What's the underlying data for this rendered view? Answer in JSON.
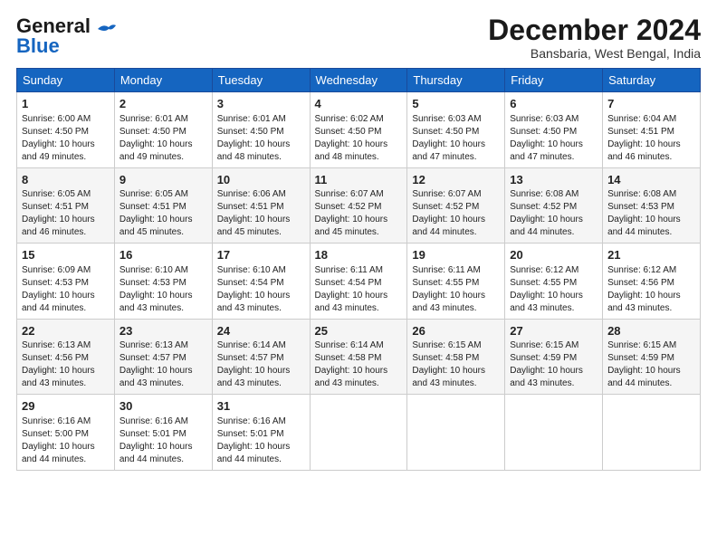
{
  "logo": {
    "line1": "General",
    "line2": "Blue"
  },
  "title": "December 2024",
  "location": "Bansbaria, West Bengal, India",
  "weekdays": [
    "Sunday",
    "Monday",
    "Tuesday",
    "Wednesday",
    "Thursday",
    "Friday",
    "Saturday"
  ],
  "weeks": [
    [
      {
        "day": "1",
        "info": "Sunrise: 6:00 AM\nSunset: 4:50 PM\nDaylight: 10 hours\nand 49 minutes."
      },
      {
        "day": "2",
        "info": "Sunrise: 6:01 AM\nSunset: 4:50 PM\nDaylight: 10 hours\nand 49 minutes."
      },
      {
        "day": "3",
        "info": "Sunrise: 6:01 AM\nSunset: 4:50 PM\nDaylight: 10 hours\nand 48 minutes."
      },
      {
        "day": "4",
        "info": "Sunrise: 6:02 AM\nSunset: 4:50 PM\nDaylight: 10 hours\nand 48 minutes."
      },
      {
        "day": "5",
        "info": "Sunrise: 6:03 AM\nSunset: 4:50 PM\nDaylight: 10 hours\nand 47 minutes."
      },
      {
        "day": "6",
        "info": "Sunrise: 6:03 AM\nSunset: 4:50 PM\nDaylight: 10 hours\nand 47 minutes."
      },
      {
        "day": "7",
        "info": "Sunrise: 6:04 AM\nSunset: 4:51 PM\nDaylight: 10 hours\nand 46 minutes."
      }
    ],
    [
      {
        "day": "8",
        "info": "Sunrise: 6:05 AM\nSunset: 4:51 PM\nDaylight: 10 hours\nand 46 minutes."
      },
      {
        "day": "9",
        "info": "Sunrise: 6:05 AM\nSunset: 4:51 PM\nDaylight: 10 hours\nand 45 minutes."
      },
      {
        "day": "10",
        "info": "Sunrise: 6:06 AM\nSunset: 4:51 PM\nDaylight: 10 hours\nand 45 minutes."
      },
      {
        "day": "11",
        "info": "Sunrise: 6:07 AM\nSunset: 4:52 PM\nDaylight: 10 hours\nand 45 minutes."
      },
      {
        "day": "12",
        "info": "Sunrise: 6:07 AM\nSunset: 4:52 PM\nDaylight: 10 hours\nand 44 minutes."
      },
      {
        "day": "13",
        "info": "Sunrise: 6:08 AM\nSunset: 4:52 PM\nDaylight: 10 hours\nand 44 minutes."
      },
      {
        "day": "14",
        "info": "Sunrise: 6:08 AM\nSunset: 4:53 PM\nDaylight: 10 hours\nand 44 minutes."
      }
    ],
    [
      {
        "day": "15",
        "info": "Sunrise: 6:09 AM\nSunset: 4:53 PM\nDaylight: 10 hours\nand 44 minutes."
      },
      {
        "day": "16",
        "info": "Sunrise: 6:10 AM\nSunset: 4:53 PM\nDaylight: 10 hours\nand 43 minutes."
      },
      {
        "day": "17",
        "info": "Sunrise: 6:10 AM\nSunset: 4:54 PM\nDaylight: 10 hours\nand 43 minutes."
      },
      {
        "day": "18",
        "info": "Sunrise: 6:11 AM\nSunset: 4:54 PM\nDaylight: 10 hours\nand 43 minutes."
      },
      {
        "day": "19",
        "info": "Sunrise: 6:11 AM\nSunset: 4:55 PM\nDaylight: 10 hours\nand 43 minutes."
      },
      {
        "day": "20",
        "info": "Sunrise: 6:12 AM\nSunset: 4:55 PM\nDaylight: 10 hours\nand 43 minutes."
      },
      {
        "day": "21",
        "info": "Sunrise: 6:12 AM\nSunset: 4:56 PM\nDaylight: 10 hours\nand 43 minutes."
      }
    ],
    [
      {
        "day": "22",
        "info": "Sunrise: 6:13 AM\nSunset: 4:56 PM\nDaylight: 10 hours\nand 43 minutes."
      },
      {
        "day": "23",
        "info": "Sunrise: 6:13 AM\nSunset: 4:57 PM\nDaylight: 10 hours\nand 43 minutes."
      },
      {
        "day": "24",
        "info": "Sunrise: 6:14 AM\nSunset: 4:57 PM\nDaylight: 10 hours\nand 43 minutes."
      },
      {
        "day": "25",
        "info": "Sunrise: 6:14 AM\nSunset: 4:58 PM\nDaylight: 10 hours\nand 43 minutes."
      },
      {
        "day": "26",
        "info": "Sunrise: 6:15 AM\nSunset: 4:58 PM\nDaylight: 10 hours\nand 43 minutes."
      },
      {
        "day": "27",
        "info": "Sunrise: 6:15 AM\nSunset: 4:59 PM\nDaylight: 10 hours\nand 43 minutes."
      },
      {
        "day": "28",
        "info": "Sunrise: 6:15 AM\nSunset: 4:59 PM\nDaylight: 10 hours\nand 44 minutes."
      }
    ],
    [
      {
        "day": "29",
        "info": "Sunrise: 6:16 AM\nSunset: 5:00 PM\nDaylight: 10 hours\nand 44 minutes."
      },
      {
        "day": "30",
        "info": "Sunrise: 6:16 AM\nSunset: 5:01 PM\nDaylight: 10 hours\nand 44 minutes."
      },
      {
        "day": "31",
        "info": "Sunrise: 6:16 AM\nSunset: 5:01 PM\nDaylight: 10 hours\nand 44 minutes."
      },
      {
        "day": "",
        "info": ""
      },
      {
        "day": "",
        "info": ""
      },
      {
        "day": "",
        "info": ""
      },
      {
        "day": "",
        "info": ""
      }
    ]
  ]
}
